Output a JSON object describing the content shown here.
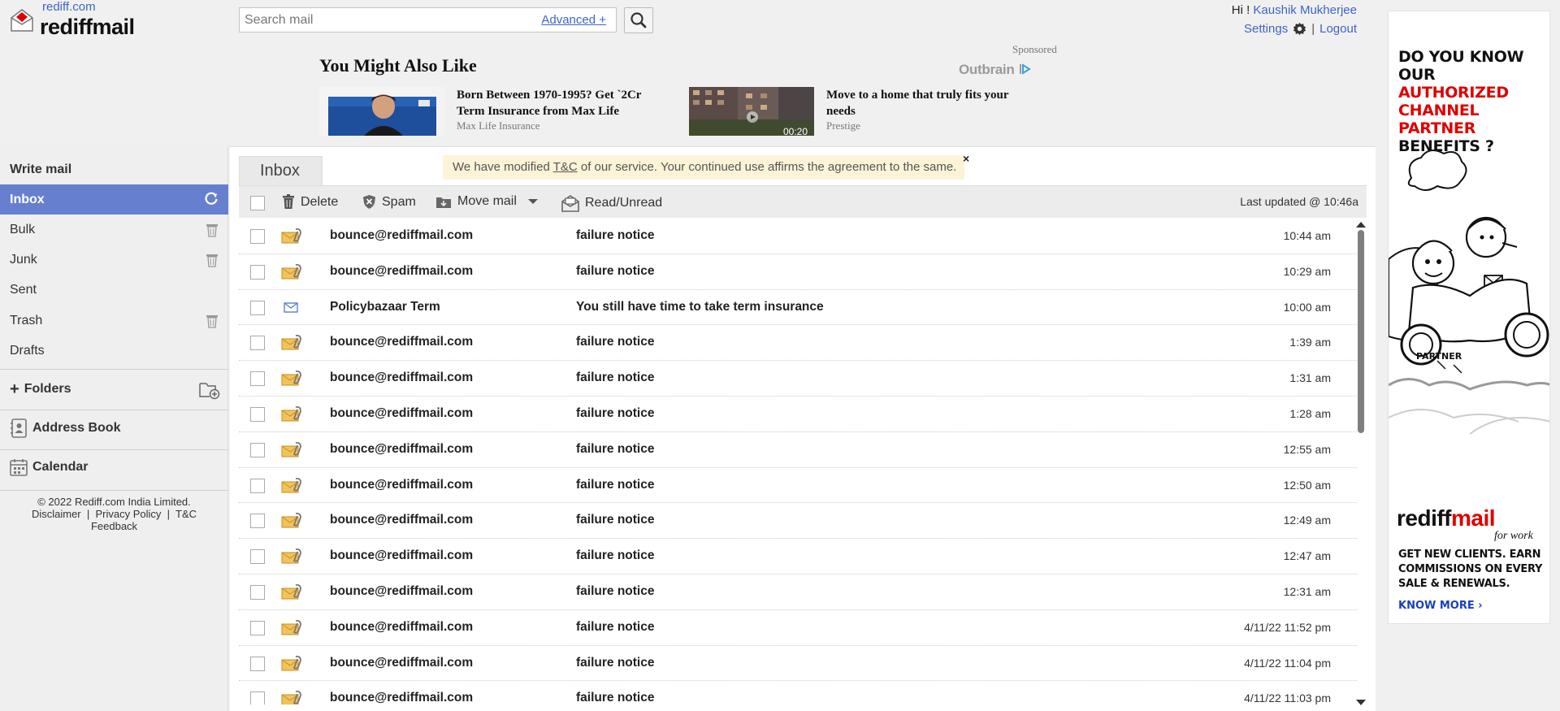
{
  "header": {
    "logo_small": "rediff.com",
    "logo_big": "rediffmail",
    "search_placeholder": "Search mail",
    "advanced_link": "Advanced +",
    "greeting": "Hi !",
    "user_name": "Kaushik Mukherjee",
    "settings_label": "Settings",
    "separator": "|",
    "logout_label": "Logout"
  },
  "ads": {
    "sponsored_label": "Sponsored",
    "outbrain_label": "Outbrain",
    "title": "You Might Also Like",
    "items": [
      {
        "title": "Born Between 1970-1995? Get `2Cr Term Insurance from Max Life",
        "source": "Max Life Insurance"
      },
      {
        "title": "Move to a home that truly fits your needs",
        "source": "Prestige",
        "video_time": "00:20"
      }
    ]
  },
  "sidebar": {
    "write_mail": "Write mail",
    "items": [
      {
        "label": "Inbox"
      },
      {
        "label": "Bulk"
      },
      {
        "label": "Junk"
      },
      {
        "label": "Sent"
      },
      {
        "label": "Trash"
      },
      {
        "label": "Drafts"
      }
    ],
    "folders_label": "Folders",
    "folders_plus": "+",
    "address_book": "Address Book",
    "calendar": "Calendar",
    "footer": {
      "copyright": "© 2022 Rediff.com India Limited.",
      "disclaimer": "Disclaimer",
      "privacy": "Privacy Policy",
      "tc": "T&C",
      "feedback": "Feedback",
      "pipe": "|"
    }
  },
  "main": {
    "tab_label": "Inbox",
    "notice_pre": "We have modified ",
    "notice_link": "T&C",
    "notice_post": " of our service. Your continued use affirms the agreement to the same.",
    "notice_close": "×",
    "toolbar": {
      "delete": "Delete",
      "spam": "Spam",
      "move_mail": "Move mail",
      "read_unread": "Read/Unread",
      "last_updated": "Last updated  @ 10:46a"
    },
    "mails": [
      {
        "from": "bounce@rediffmail.com",
        "subject": "failure notice",
        "time": "10:44 am",
        "icon": "attachment"
      },
      {
        "from": "bounce@rediffmail.com",
        "subject": "failure notice",
        "time": "10:29 am",
        "icon": "attachment"
      },
      {
        "from": "Policybazaar Term",
        "subject": "You still have time to take term insurance",
        "time": "10:00 am",
        "icon": "envelope"
      },
      {
        "from": "bounce@rediffmail.com",
        "subject": "failure notice",
        "time": "1:39 am",
        "icon": "attachment"
      },
      {
        "from": "bounce@rediffmail.com",
        "subject": "failure notice",
        "time": "1:31 am",
        "icon": "attachment"
      },
      {
        "from": "bounce@rediffmail.com",
        "subject": "failure notice",
        "time": "1:28 am",
        "icon": "attachment"
      },
      {
        "from": "bounce@rediffmail.com",
        "subject": "failure notice",
        "time": "12:55 am",
        "icon": "attachment"
      },
      {
        "from": "bounce@rediffmail.com",
        "subject": "failure notice",
        "time": "12:50 am",
        "icon": "attachment"
      },
      {
        "from": "bounce@rediffmail.com",
        "subject": "failure notice",
        "time": "12:49 am",
        "icon": "attachment"
      },
      {
        "from": "bounce@rediffmail.com",
        "subject": "failure notice",
        "time": "12:47 am",
        "icon": "attachment"
      },
      {
        "from": "bounce@rediffmail.com",
        "subject": "failure notice",
        "time": "12:31 am",
        "icon": "attachment"
      },
      {
        "from": "bounce@rediffmail.com",
        "subject": "failure notice",
        "time": "4/11/22 11:52 pm",
        "icon": "attachment"
      },
      {
        "from": "bounce@rediffmail.com",
        "subject": "failure notice",
        "time": "4/11/22 11:04 pm",
        "icon": "attachment"
      },
      {
        "from": "bounce@rediffmail.com",
        "subject": "failure notice",
        "time": "4/11/22 11:03 pm",
        "icon": "attachment"
      }
    ]
  },
  "right_ad": {
    "head_line1": "DO YOU KNOW OUR",
    "head_line2": "AUTHORIZED",
    "head_line3": "CHANNEL PARTNER",
    "head_line4": "BENEFITS ?",
    "partner_label": "PARTNER",
    "logo_black": "rediff",
    "logo_red": "mail",
    "logo_sub": "for work",
    "body": "GET NEW CLIENTS. EARN COMMISSIONS ON EVERY SALE & RENEWALS.",
    "cta": "KNOW MORE ›"
  },
  "colors": {
    "accent": "#6680cf",
    "link": "#3e64c8",
    "notice_bg": "#fdf3d6",
    "ad_red": "#dd0000"
  }
}
